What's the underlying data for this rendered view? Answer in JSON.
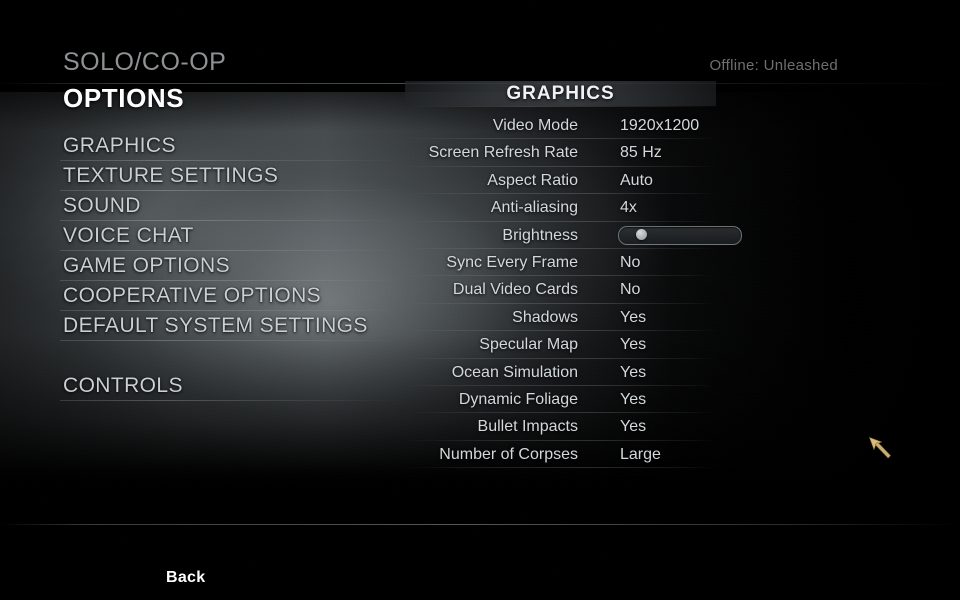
{
  "header": {
    "kicker": "SOLO/CO-OP",
    "title": "OPTIONS",
    "status": "Offline: Unleashed"
  },
  "sidebar": {
    "items": [
      {
        "label": "GRAPHICS"
      },
      {
        "label": "TEXTURE SETTINGS"
      },
      {
        "label": "SOUND"
      },
      {
        "label": "VOICE CHAT"
      },
      {
        "label": "GAME OPTIONS"
      },
      {
        "label": "COOPERATIVE OPTIONS"
      },
      {
        "label": "DEFAULT SYSTEM SETTINGS"
      }
    ],
    "secondary": [
      {
        "label": "CONTROLS"
      }
    ]
  },
  "panel": {
    "title": "GRAPHICS",
    "rows": [
      {
        "label": "Video Mode",
        "value": "1920x1200"
      },
      {
        "label": "Screen Refresh Rate",
        "value": "85 Hz"
      },
      {
        "label": "Aspect Ratio",
        "value": "Auto"
      },
      {
        "label": "Anti-aliasing",
        "value": "4x"
      },
      {
        "label": "Brightness",
        "value": "",
        "control": "slider",
        "slider_percent": 14
      },
      {
        "label": "Sync Every Frame",
        "value": "No"
      },
      {
        "label": "Dual Video Cards",
        "value": "No"
      },
      {
        "label": "Shadows",
        "value": "Yes"
      },
      {
        "label": "Specular Map",
        "value": "Yes"
      },
      {
        "label": "Ocean Simulation",
        "value": "Yes"
      },
      {
        "label": "Dynamic Foliage",
        "value": "Yes"
      },
      {
        "label": "Bullet Impacts",
        "value": "Yes"
      },
      {
        "label": "Number of Corpses",
        "value": "Large"
      }
    ]
  },
  "footer": {
    "back_label": "Back"
  },
  "colors": {
    "background": "#000000",
    "title_text": "#ffffff",
    "body_text": "#d2d8db",
    "muted_text": "#6d7073",
    "cursor": "#d9bd7e"
  }
}
